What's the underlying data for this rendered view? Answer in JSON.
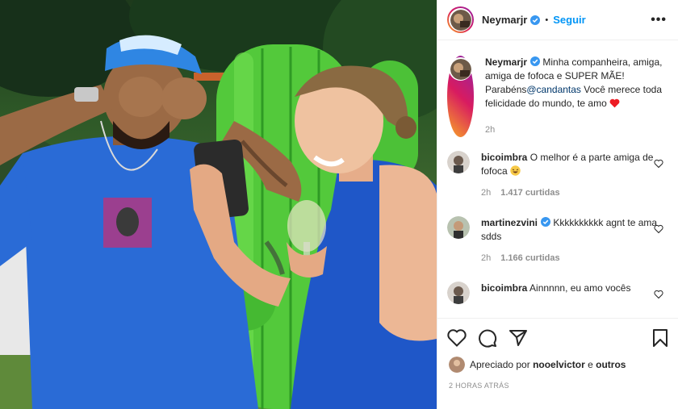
{
  "post": {
    "username": "Neymarjr",
    "separator": "•",
    "follow_label": "Seguir",
    "more_label": "•••"
  },
  "caption": {
    "username": "Neymarjr",
    "text_a": "Minha companheira, amiga, amiga de fofoca e SUPER MÃE! Parabéns",
    "mention": "@candantas",
    "text_b": "Você merece toda felicidade do mundo, te amo",
    "emoji": "heart-emoji",
    "time": "2h"
  },
  "comments": [
    {
      "username": "bicoimbra",
      "text": "O melhor é a parte amiga de fofoca",
      "emoji": "laughing-emoji",
      "time": "2h",
      "likes": "1.417 curtidas"
    },
    {
      "username": "martinezvini",
      "text": "Kkkkkkkkkk agnt te ama sdds",
      "time": "2h",
      "likes": "1.166 curtidas"
    },
    {
      "username": "bicoimbra",
      "text": "Ainnnnn, eu amo vocês"
    }
  ],
  "liked_by": {
    "prefix": "Apreciado por",
    "user": "nooelvictor",
    "conj": "e",
    "others": "outros"
  },
  "timestamp": "2 HORAS ATRÁS",
  "icons": {
    "verified": "verified-badge-icon",
    "like": "heart-outline-icon",
    "comment": "comment-bubble-icon",
    "share": "paper-plane-icon",
    "save": "bookmark-icon"
  },
  "colors": {
    "verified": "#3897f0",
    "link": "#0095f6",
    "heart": "#ed4956",
    "muted": "#8e8e8e"
  }
}
